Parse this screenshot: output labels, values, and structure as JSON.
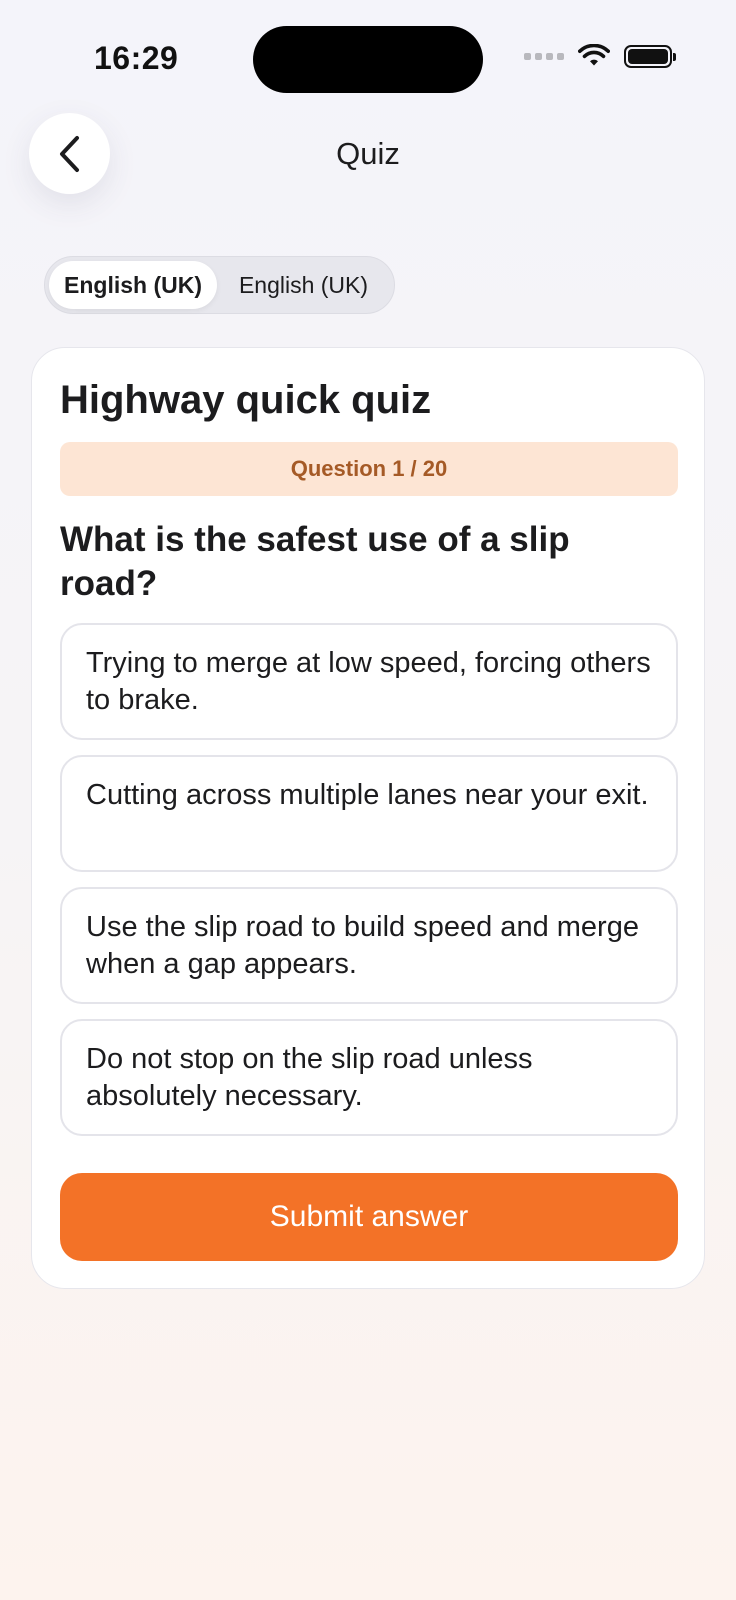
{
  "status_bar": {
    "time": "16:29"
  },
  "header": {
    "title": "Quiz",
    "back_icon": "chevron-left-icon"
  },
  "language_toggle": {
    "options": [
      {
        "label": "English (UK)",
        "selected": true
      },
      {
        "label": "English (UK)",
        "selected": false
      }
    ]
  },
  "quiz": {
    "title": "Highway quick quiz",
    "progress": "Question 1 / 20",
    "question": "What is the safest use of a slip road?",
    "answers": [
      "Trying to merge at low speed, forcing others to brake.",
      "Cutting across multiple lanes near your exit.",
      "Use the slip road to build speed and merge when a gap appears.",
      "Do not stop on the slip road unless absolutely necessary."
    ],
    "submit_label": "Submit answer"
  },
  "colors": {
    "accent": "#f37227",
    "badge_bg": "#fde5d4",
    "badge_text": "#a55a26"
  }
}
